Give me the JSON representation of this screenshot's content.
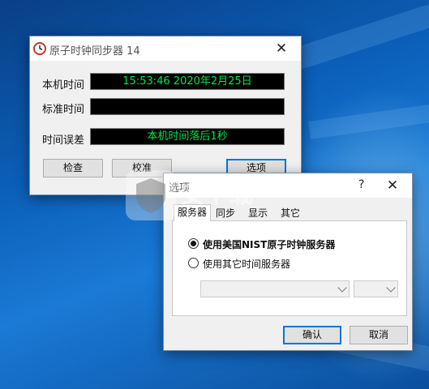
{
  "main_window": {
    "title": "原子时钟同步器 14",
    "local_time_label": "本机时间",
    "local_time_value": "15:53:46  2020年2月25日",
    "standard_time_label": "标准时间",
    "standard_time_value": "",
    "time_error_label": "时间误差",
    "time_error_value": "本机时间落后1秒",
    "buttons": {
      "check": "检查",
      "calibrate": "校准",
      "options": "选项"
    },
    "lcd_color": "#00e64d"
  },
  "options_dialog": {
    "title": "选项",
    "help": "?",
    "tabs": [
      "服务器",
      "同步",
      "显示",
      "其它"
    ],
    "radio_nist": "使用美国NIST原子时钟服务器",
    "radio_other": "使用其它时间服务器",
    "server_value": "",
    "buttons": {
      "ok": "确认",
      "cancel": "取消"
    },
    "accent": "#0078d7"
  },
  "watermark": "安下载"
}
